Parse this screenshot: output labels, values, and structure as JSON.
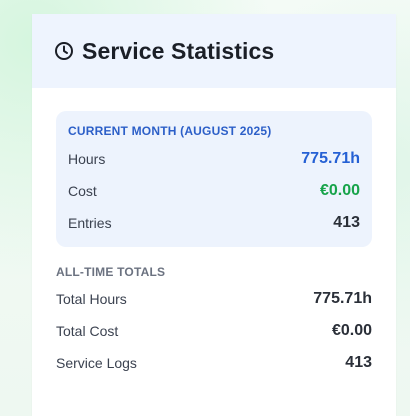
{
  "header": {
    "icon": "clock-icon",
    "title": "Service Statistics"
  },
  "current_month": {
    "label": "CURRENT MONTH (AUGUST 2025)",
    "rows": [
      {
        "label": "Hours",
        "value": "775.71h"
      },
      {
        "label": "Cost",
        "value": "€0.00"
      },
      {
        "label": "Entries",
        "value": "413"
      }
    ]
  },
  "all_time": {
    "label": "ALL-TIME TOTALS",
    "rows": [
      {
        "label": "Total Hours",
        "value": "775.71h"
      },
      {
        "label": "Total Cost",
        "value": "€0.00"
      },
      {
        "label": "Service Logs",
        "value": "413"
      }
    ]
  },
  "colors": {
    "accent_blue": "#2560d4",
    "accent_green": "#17a34a",
    "header_bg": "#eef4fe",
    "month_box_bg": "#edf3fd"
  }
}
